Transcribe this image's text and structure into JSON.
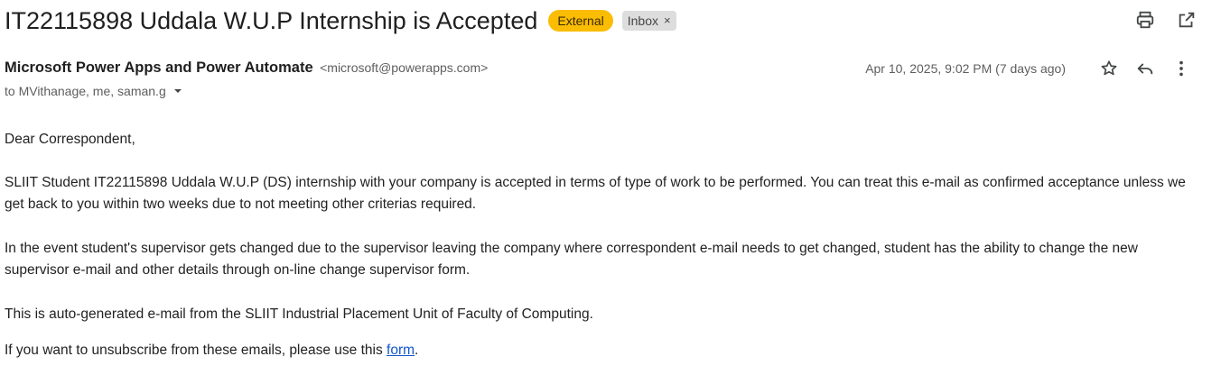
{
  "email": {
    "subject": "IT22115898 Uddala W.U.P Internship is Accepted",
    "labels": {
      "external": "External",
      "inbox": "Inbox",
      "inbox_remove": "×"
    },
    "sender": {
      "name": "Microsoft Power Apps and Power Automate",
      "email": "<microsoft@powerapps.com>"
    },
    "recipients": "to MVithanage, me, saman.g",
    "date": "Apr 10, 2025, 9:02 PM (7 days ago)",
    "body": {
      "greeting": "Dear Correspondent,",
      "paragraph1": "SLIIT Student IT22115898 Uddala W.U.P  (DS)  internship with your company is accepted in terms of type of work to be performed. You can treat this e-mail as confirmed acceptance unless we get back to you within two weeks due to not meeting other criterias required.",
      "paragraph2": "In the event student's supervisor gets changed due to the supervisor leaving the company where correspondent e-mail needs to get changed, student has the ability to change the new supervisor e-mail and other details through on-line change supervisor form.",
      "paragraph3": "This is auto-generated e-mail from the SLIIT Industrial Placement Unit of Faculty of Computing.",
      "unsubscribe_prefix": "If you want to unsubscribe from these emails, please use this ",
      "unsubscribe_link": "form",
      "unsubscribe_suffix": "."
    }
  },
  "icons": {
    "print": "print-icon",
    "open_new_window": "open-in-new-icon",
    "star": "star-icon",
    "reply": "reply-icon",
    "more": "more-vert-icon",
    "caret": "caret-down-icon"
  },
  "colors": {
    "external_chip": "#fbbc04",
    "inbox_chip": "#dddddd",
    "link": "#1155cc"
  }
}
